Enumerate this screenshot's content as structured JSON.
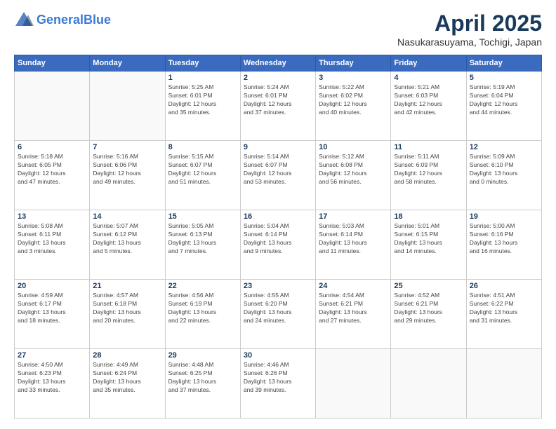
{
  "header": {
    "logo_line1": "General",
    "logo_line2": "Blue",
    "month": "April 2025",
    "location": "Nasukarasuyama, Tochigi, Japan"
  },
  "weekdays": [
    "Sunday",
    "Monday",
    "Tuesday",
    "Wednesday",
    "Thursday",
    "Friday",
    "Saturday"
  ],
  "weeks": [
    [
      {
        "day": "",
        "info": ""
      },
      {
        "day": "",
        "info": ""
      },
      {
        "day": "1",
        "info": "Sunrise: 5:25 AM\nSunset: 6:01 PM\nDaylight: 12 hours\nand 35 minutes."
      },
      {
        "day": "2",
        "info": "Sunrise: 5:24 AM\nSunset: 6:01 PM\nDaylight: 12 hours\nand 37 minutes."
      },
      {
        "day": "3",
        "info": "Sunrise: 5:22 AM\nSunset: 6:02 PM\nDaylight: 12 hours\nand 40 minutes."
      },
      {
        "day": "4",
        "info": "Sunrise: 5:21 AM\nSunset: 6:03 PM\nDaylight: 12 hours\nand 42 minutes."
      },
      {
        "day": "5",
        "info": "Sunrise: 5:19 AM\nSunset: 6:04 PM\nDaylight: 12 hours\nand 44 minutes."
      }
    ],
    [
      {
        "day": "6",
        "info": "Sunrise: 5:18 AM\nSunset: 6:05 PM\nDaylight: 12 hours\nand 47 minutes."
      },
      {
        "day": "7",
        "info": "Sunrise: 5:16 AM\nSunset: 6:06 PM\nDaylight: 12 hours\nand 49 minutes."
      },
      {
        "day": "8",
        "info": "Sunrise: 5:15 AM\nSunset: 6:07 PM\nDaylight: 12 hours\nand 51 minutes."
      },
      {
        "day": "9",
        "info": "Sunrise: 5:14 AM\nSunset: 6:07 PM\nDaylight: 12 hours\nand 53 minutes."
      },
      {
        "day": "10",
        "info": "Sunrise: 5:12 AM\nSunset: 6:08 PM\nDaylight: 12 hours\nand 56 minutes."
      },
      {
        "day": "11",
        "info": "Sunrise: 5:11 AM\nSunset: 6:09 PM\nDaylight: 12 hours\nand 58 minutes."
      },
      {
        "day": "12",
        "info": "Sunrise: 5:09 AM\nSunset: 6:10 PM\nDaylight: 13 hours\nand 0 minutes."
      }
    ],
    [
      {
        "day": "13",
        "info": "Sunrise: 5:08 AM\nSunset: 6:11 PM\nDaylight: 13 hours\nand 3 minutes."
      },
      {
        "day": "14",
        "info": "Sunrise: 5:07 AM\nSunset: 6:12 PM\nDaylight: 13 hours\nand 5 minutes."
      },
      {
        "day": "15",
        "info": "Sunrise: 5:05 AM\nSunset: 6:13 PM\nDaylight: 13 hours\nand 7 minutes."
      },
      {
        "day": "16",
        "info": "Sunrise: 5:04 AM\nSunset: 6:14 PM\nDaylight: 13 hours\nand 9 minutes."
      },
      {
        "day": "17",
        "info": "Sunrise: 5:03 AM\nSunset: 6:14 PM\nDaylight: 13 hours\nand 11 minutes."
      },
      {
        "day": "18",
        "info": "Sunrise: 5:01 AM\nSunset: 6:15 PM\nDaylight: 13 hours\nand 14 minutes."
      },
      {
        "day": "19",
        "info": "Sunrise: 5:00 AM\nSunset: 6:16 PM\nDaylight: 13 hours\nand 16 minutes."
      }
    ],
    [
      {
        "day": "20",
        "info": "Sunrise: 4:59 AM\nSunset: 6:17 PM\nDaylight: 13 hours\nand 18 minutes."
      },
      {
        "day": "21",
        "info": "Sunrise: 4:57 AM\nSunset: 6:18 PM\nDaylight: 13 hours\nand 20 minutes."
      },
      {
        "day": "22",
        "info": "Sunrise: 4:56 AM\nSunset: 6:19 PM\nDaylight: 13 hours\nand 22 minutes."
      },
      {
        "day": "23",
        "info": "Sunrise: 4:55 AM\nSunset: 6:20 PM\nDaylight: 13 hours\nand 24 minutes."
      },
      {
        "day": "24",
        "info": "Sunrise: 4:54 AM\nSunset: 6:21 PM\nDaylight: 13 hours\nand 27 minutes."
      },
      {
        "day": "25",
        "info": "Sunrise: 4:52 AM\nSunset: 6:21 PM\nDaylight: 13 hours\nand 29 minutes."
      },
      {
        "day": "26",
        "info": "Sunrise: 4:51 AM\nSunset: 6:22 PM\nDaylight: 13 hours\nand 31 minutes."
      }
    ],
    [
      {
        "day": "27",
        "info": "Sunrise: 4:50 AM\nSunset: 6:23 PM\nDaylight: 13 hours\nand 33 minutes."
      },
      {
        "day": "28",
        "info": "Sunrise: 4:49 AM\nSunset: 6:24 PM\nDaylight: 13 hours\nand 35 minutes."
      },
      {
        "day": "29",
        "info": "Sunrise: 4:48 AM\nSunset: 6:25 PM\nDaylight: 13 hours\nand 37 minutes."
      },
      {
        "day": "30",
        "info": "Sunrise: 4:46 AM\nSunset: 6:26 PM\nDaylight: 13 hours\nand 39 minutes."
      },
      {
        "day": "",
        "info": ""
      },
      {
        "day": "",
        "info": ""
      },
      {
        "day": "",
        "info": ""
      }
    ]
  ]
}
